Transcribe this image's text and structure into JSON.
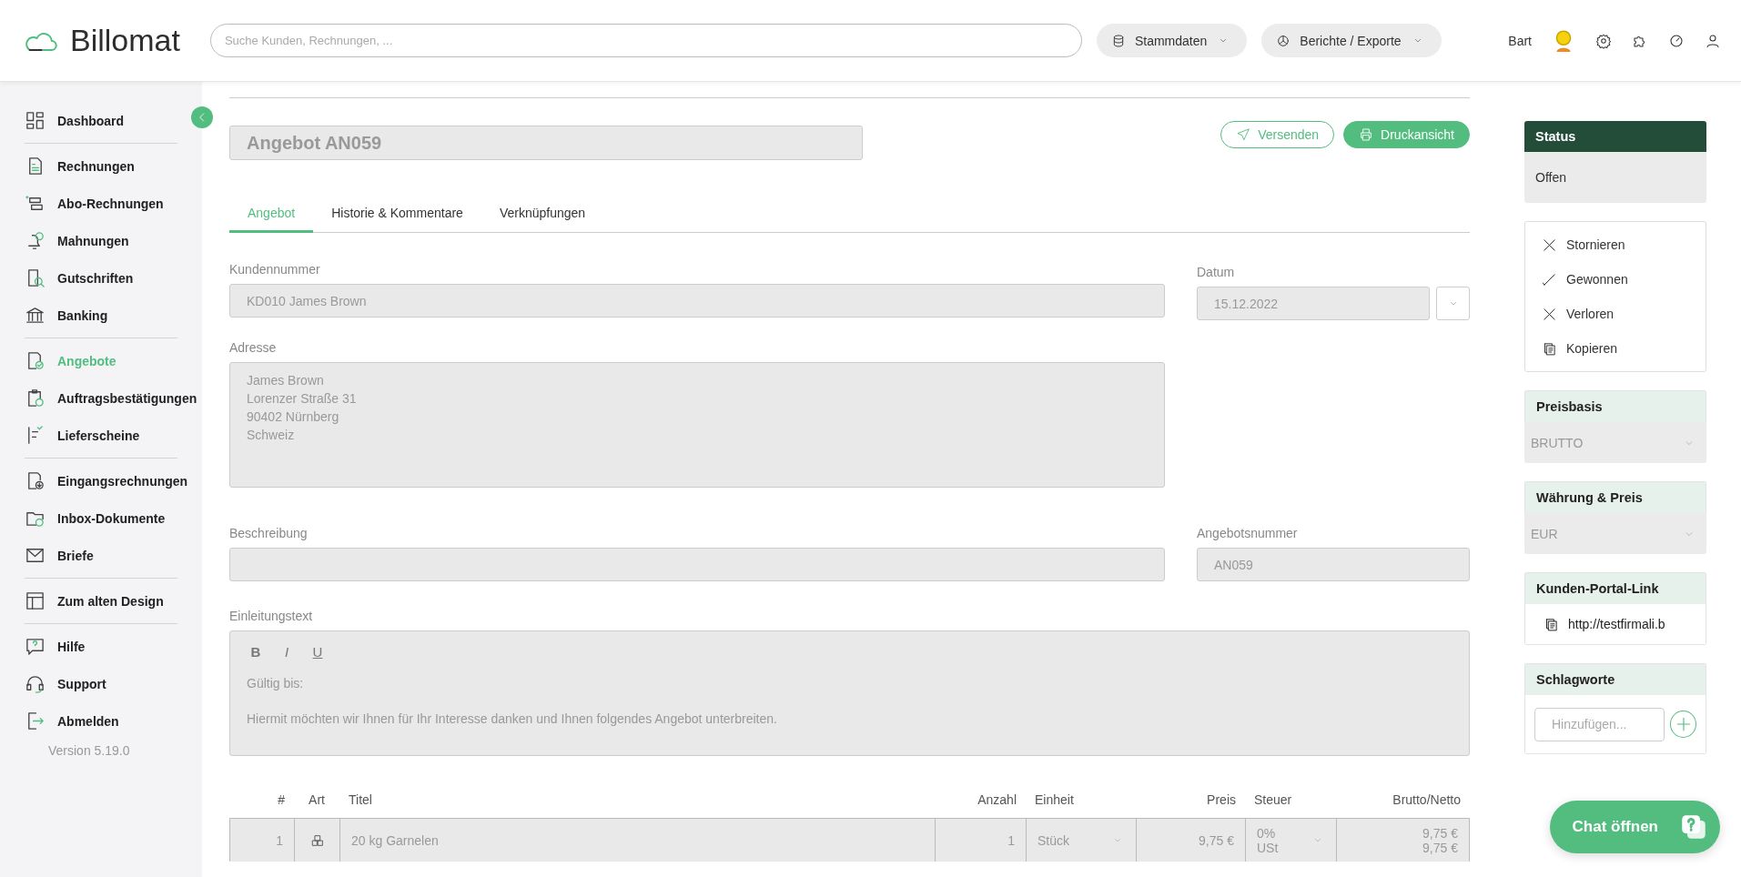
{
  "header": {
    "logo": "Billomat",
    "search": {
      "placeholder": "Suche Kunden, Rechnungen, ..."
    },
    "menus": [
      {
        "label": "Stammdaten"
      },
      {
        "label": "Berichte / Exporte"
      }
    ],
    "user": "Bart"
  },
  "sidebar": {
    "groups": [
      [
        {
          "label": "Dashboard",
          "selected": false
        }
      ],
      [
        {
          "label": "Rechnungen",
          "selected": false
        },
        {
          "label": "Abo-Rechnungen",
          "selected": false
        },
        {
          "label": "Mahnungen",
          "selected": false
        },
        {
          "label": "Gutschriften",
          "selected": false
        },
        {
          "label": "Banking",
          "selected": false
        }
      ],
      [
        {
          "label": "Angebote",
          "selected": true
        },
        {
          "label": "Auftragsbestätigungen",
          "selected": false
        },
        {
          "label": "Lieferscheine",
          "selected": false
        }
      ],
      [
        {
          "label": "Eingangsrechnungen",
          "selected": false
        },
        {
          "label": "Inbox-Dokumente",
          "selected": false
        },
        {
          "label": "Briefe",
          "selected": false
        }
      ],
      [
        {
          "label": "Zum alten Design",
          "selected": false
        }
      ],
      [
        {
          "label": "Hilfe",
          "selected": false
        },
        {
          "label": "Support",
          "selected": false
        },
        {
          "label": "Abmelden",
          "selected": false
        }
      ]
    ],
    "version": "Version 5.19.0"
  },
  "document": {
    "title": "Angebot AN059",
    "buttons": [
      {
        "label": "Versenden",
        "kind": "outline"
      },
      {
        "label": "Druckansicht",
        "kind": "primary"
      }
    ],
    "tabs": [
      {
        "label": "Angebot",
        "selected": true
      },
      {
        "label": "Historie & Kommentare",
        "selected": false
      },
      {
        "label": "Verknüpfungen",
        "selected": false
      }
    ],
    "customer_number": {
      "label": "Kundennummer",
      "value": "KD010 James Brown"
    },
    "date": {
      "label": "Datum",
      "value": "15.12.2022"
    },
    "address": {
      "label": "Adresse",
      "lines": [
        "James Brown",
        "Lorenzer Straße 31",
        "90402 Nürnberg",
        "Schweiz"
      ]
    },
    "description": {
      "label": "Beschreibung"
    },
    "offer_number": {
      "label": "Angebotsnummer",
      "value": "AN059"
    },
    "intro": {
      "label": "Einleitungstext",
      "toolbar": [
        "B",
        "I",
        "U"
      ],
      "lines": [
        "Gültig bis:",
        "Hiermit möchten wir Ihnen für Ihr Interesse danken und Ihnen folgendes Angebot unterbreiten."
      ]
    },
    "table": {
      "columns": [
        {
          "label": "#"
        },
        {
          "label": "Art"
        },
        {
          "label": "Titel"
        },
        {
          "label": "Anzahl"
        },
        {
          "label": "Einheit"
        },
        {
          "label": "Preis"
        },
        {
          "label": "Steuer"
        },
        {
          "label": "Brutto/Netto"
        }
      ],
      "rows": [
        {
          "number": "1",
          "title": "20 kg Garnelen",
          "quantity": "1",
          "unit": "Stück",
          "price": "9,75 €",
          "tax": [
            "0%",
            "USt"
          ],
          "totals": [
            "9,75 €",
            "9,75 €"
          ]
        }
      ]
    }
  },
  "panel": {
    "status": {
      "title": "Status",
      "value": "Offen"
    },
    "actions": [
      {
        "label": "Stornieren",
        "kind": "cancel"
      },
      {
        "label": "Gewonnen",
        "kind": "won"
      },
      {
        "label": "Verloren",
        "kind": "lost"
      },
      {
        "label": "Kopieren",
        "kind": "copy"
      }
    ],
    "price_basis": {
      "title": "Preisbasis",
      "value": "BRUTTO"
    },
    "currency": {
      "title": "Währung & Preis",
      "value": "EUR"
    },
    "portal_link": {
      "title": "Kunden-Portal-Link",
      "url": "http://testfirmali.b"
    },
    "tags": {
      "title": "Schlagworte",
      "placeholder": "Hinzufügen..."
    }
  },
  "chat": {
    "label": "Chat öffnen"
  }
}
